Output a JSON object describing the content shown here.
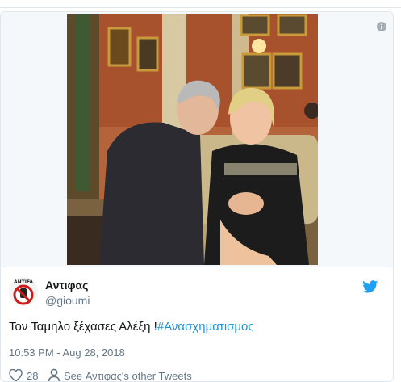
{
  "tweet": {
    "author_name": "Αντιφας",
    "author_handle": "@gioumi",
    "avatar_label": "ANTIFA",
    "text_plain": "Τον Ταμηλο ξέχασες Αλέξη !",
    "text_hashtag": "#Ανασχηματισμος",
    "timestamp": "10:53 PM - Aug 28, 2018",
    "like_count": "28",
    "other_tweets_label": "See Αντιφας's other Tweets"
  },
  "colors": {
    "accent_blue": "#1b95e0",
    "twitter_blue": "#1da1f2",
    "text_secondary": "#657786",
    "border": "#e1e8ed"
  },
  "icons": {
    "info": "info-icon",
    "brand": "twitter-bird-icon",
    "like": "heart-icon",
    "profile": "person-icon"
  }
}
